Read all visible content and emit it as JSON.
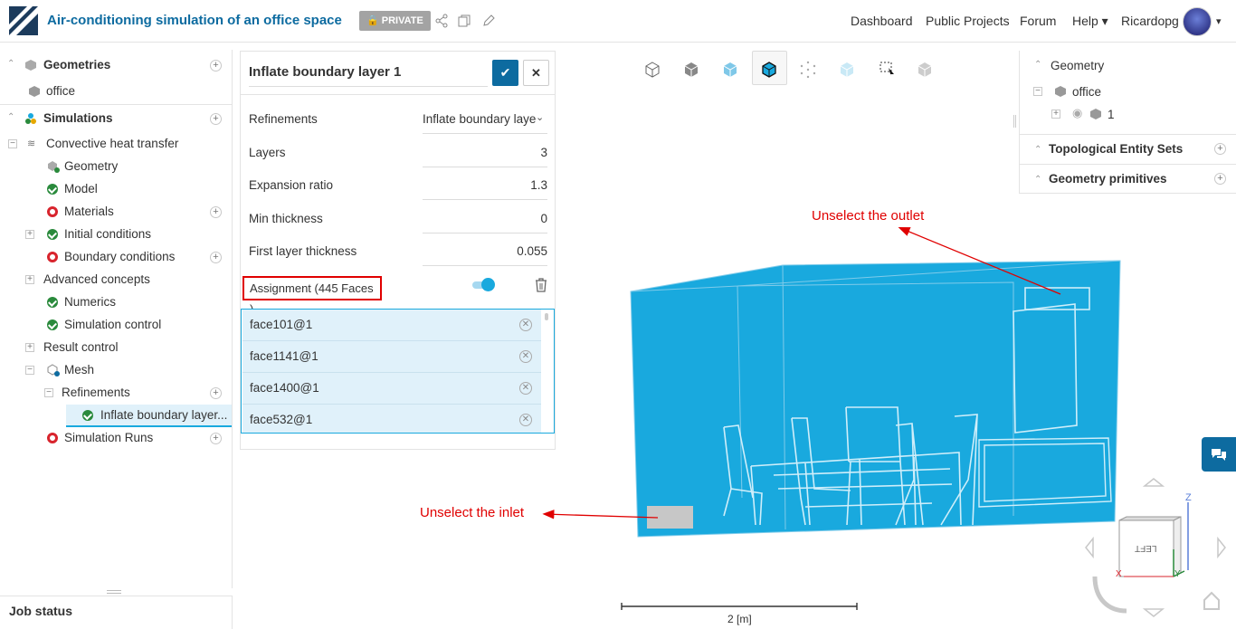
{
  "header": {
    "title": "Air-conditioning simulation of an office space",
    "private_badge": "PRIVATE",
    "nav": [
      "Dashboard",
      "Public Projects",
      "Forum",
      "Help"
    ],
    "user": "Ricardopg"
  },
  "tree": {
    "geometries_label": "Geometries",
    "geometry_item": "office",
    "simulations_label": "Simulations",
    "sim_name": "Convective heat transfer",
    "items": [
      "Geometry",
      "Model",
      "Materials",
      "Initial conditions",
      "Boundary conditions",
      "Advanced concepts",
      "Numerics",
      "Simulation control",
      "Result control",
      "Mesh",
      "Refinements",
      "Inflate boundary layer...",
      "Simulation Runs"
    ]
  },
  "panel": {
    "title": "Inflate boundary layer 1",
    "refinements_label": "Refinements",
    "refinements_value": "Inflate boundary laye",
    "layers_label": "Layers",
    "layers_value": "3",
    "expansion_label": "Expansion ratio",
    "expansion_value": "1.3",
    "min_label": "Min thickness",
    "min_value": "0",
    "first_label": "First layer thickness",
    "first_value": "0.055",
    "assignment_label": "Assignment (445 Faces )",
    "faces": [
      "face101@1",
      "face1141@1",
      "face1400@1",
      "face532@1"
    ]
  },
  "right_panel": {
    "geometry_label": "Geometry",
    "office": "office",
    "part": "1",
    "topo_label": "Topological Entity Sets",
    "prim_label": "Geometry primitives"
  },
  "viewport": {
    "annot_outlet": "Unselect the outlet",
    "annot_inlet": "Unselect the inlet",
    "scale_label": "2 [m]",
    "cube_face": "LEFT",
    "axis_z": "Z",
    "axis_x": "X",
    "axis_y": "Y"
  },
  "footer": {
    "job_status": "Job status"
  },
  "colors": {
    "brand": "#0d6ba0",
    "model": "#19a9de",
    "annotation": "#e00000"
  }
}
